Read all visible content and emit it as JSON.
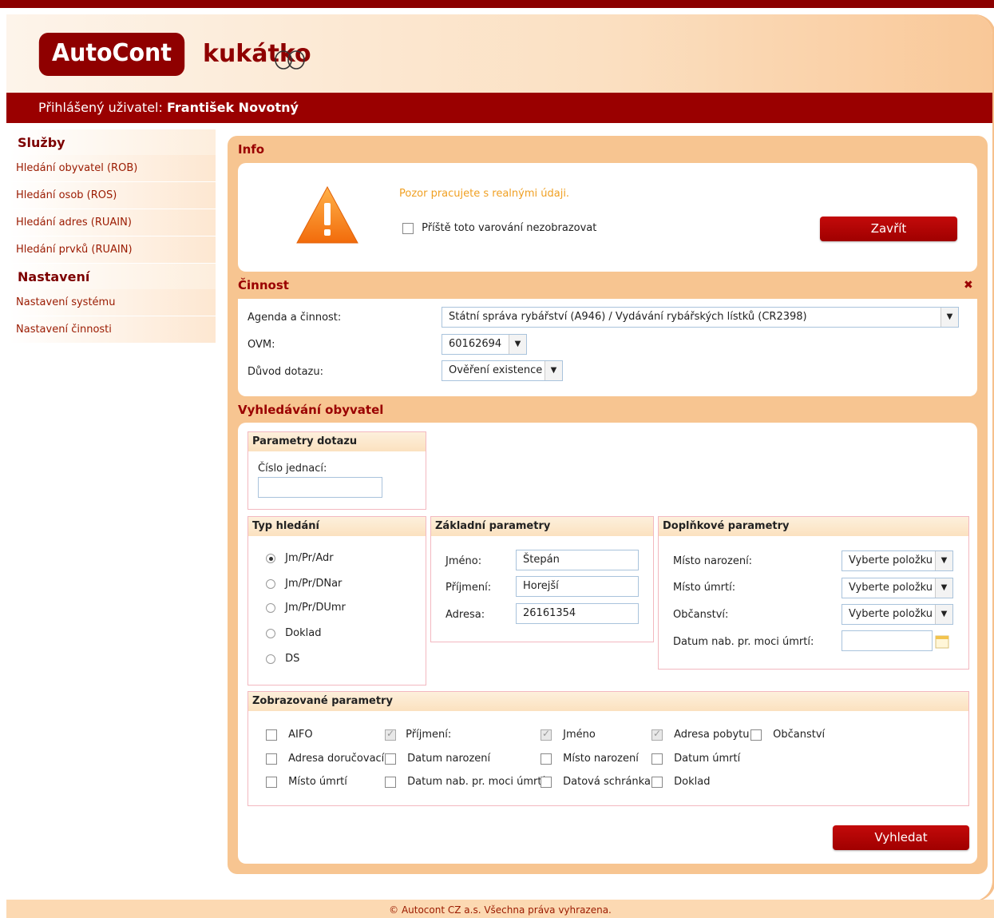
{
  "header": {
    "logo": "AutoCont",
    "logo_sub": "kukátko",
    "user_label": "Přihlášený uživatel:",
    "user_name": "František Novotný"
  },
  "sidebar": {
    "services_title": "Služby",
    "services": [
      {
        "label": "Hledání obyvatel (ROB)"
      },
      {
        "label": "Hledání osob (ROS)"
      },
      {
        "label": "Hledání adres (RUAIN)"
      },
      {
        "label": "Hledání prvků (RUAIN)"
      }
    ],
    "settings_title": "Nastavení",
    "settings": [
      {
        "label": "Nastavení systému"
      },
      {
        "label": "Nastavení činnosti"
      }
    ]
  },
  "info": {
    "title": "Info",
    "warning": "Pozor pracujete s realnými údaji.",
    "dont_show_label": "Příště toto varování nezobrazovat",
    "close_label": "Zavřít"
  },
  "cinnost": {
    "title": "Činnost",
    "close_glyph": "✖",
    "agenda_label": "Agenda a činnost:",
    "agenda_value": "Státní správa rybářství (A946) / Vydávání rybářských lístků (CR2398)",
    "ovm_label": "OVM:",
    "ovm_value": "60162694",
    "reason_label": "Důvod dotazu:",
    "reason_value": "Ověření existence"
  },
  "search": {
    "title": "Vyhledávání obyvatel",
    "query_params": {
      "title": "Parametry dotazu",
      "ref_label": "Číslo jednací:",
      "ref_value": ""
    },
    "search_type": {
      "title": "Typ hledání",
      "options": [
        {
          "label": "Jm/Pr/Adr",
          "selected": true
        },
        {
          "label": "Jm/Pr/DNar",
          "selected": false
        },
        {
          "label": "Jm/Pr/DUmr",
          "selected": false
        },
        {
          "label": "Doklad",
          "selected": false
        },
        {
          "label": "DS",
          "selected": false
        }
      ]
    },
    "basic": {
      "title": "Základní parametry",
      "name_label": "Jméno:",
      "name_value": "Štepán",
      "surname_label": "Příjmení:",
      "surname_value": "Horejší",
      "address_label": "Adresa:",
      "address_value": "26161354"
    },
    "extra": {
      "title": "Doplňkové parametry",
      "birthplace_label": "Místo narození:",
      "birthplace_value": "Vyberte položku",
      "deathplace_label": "Místo úmrtí:",
      "deathplace_value": "Vyberte položku",
      "citizenship_label": "Občanství:",
      "citizenship_value": "Vyberte položku",
      "death_date_label": "Datum nab. pr. moci úmrtí:",
      "death_date_value": ""
    },
    "shown": {
      "title": "Zobrazované parametry",
      "items": [
        {
          "label": "AIFO",
          "checked": false
        },
        {
          "label": "Příjmení:",
          "checked": true
        },
        {
          "label": "Jméno",
          "checked": true
        },
        {
          "label": "Adresa pobytu",
          "checked": true
        },
        {
          "label": "Občanství",
          "checked": false
        },
        {
          "label": "Adresa doručovací",
          "checked": false
        },
        {
          "label": "Datum narození",
          "checked": false
        },
        {
          "label": "Místo narození",
          "checked": false
        },
        {
          "label": "Datum úmrtí",
          "checked": false
        },
        {
          "label": "Místo úmrtí",
          "checked": false
        },
        {
          "label": "Datum nab. pr. moci úmrtí",
          "checked": false
        },
        {
          "label": "Datová schránka",
          "checked": false
        },
        {
          "label": "Doklad",
          "checked": false
        }
      ]
    },
    "search_button": "Vyhledat"
  },
  "footer": {
    "text": "© Autocont CZ a.s. Všechna práva vyhrazena."
  },
  "colors": {
    "brand": "#9a0000",
    "warning": "#f0a023",
    "panel_bg": "#f7c591"
  }
}
